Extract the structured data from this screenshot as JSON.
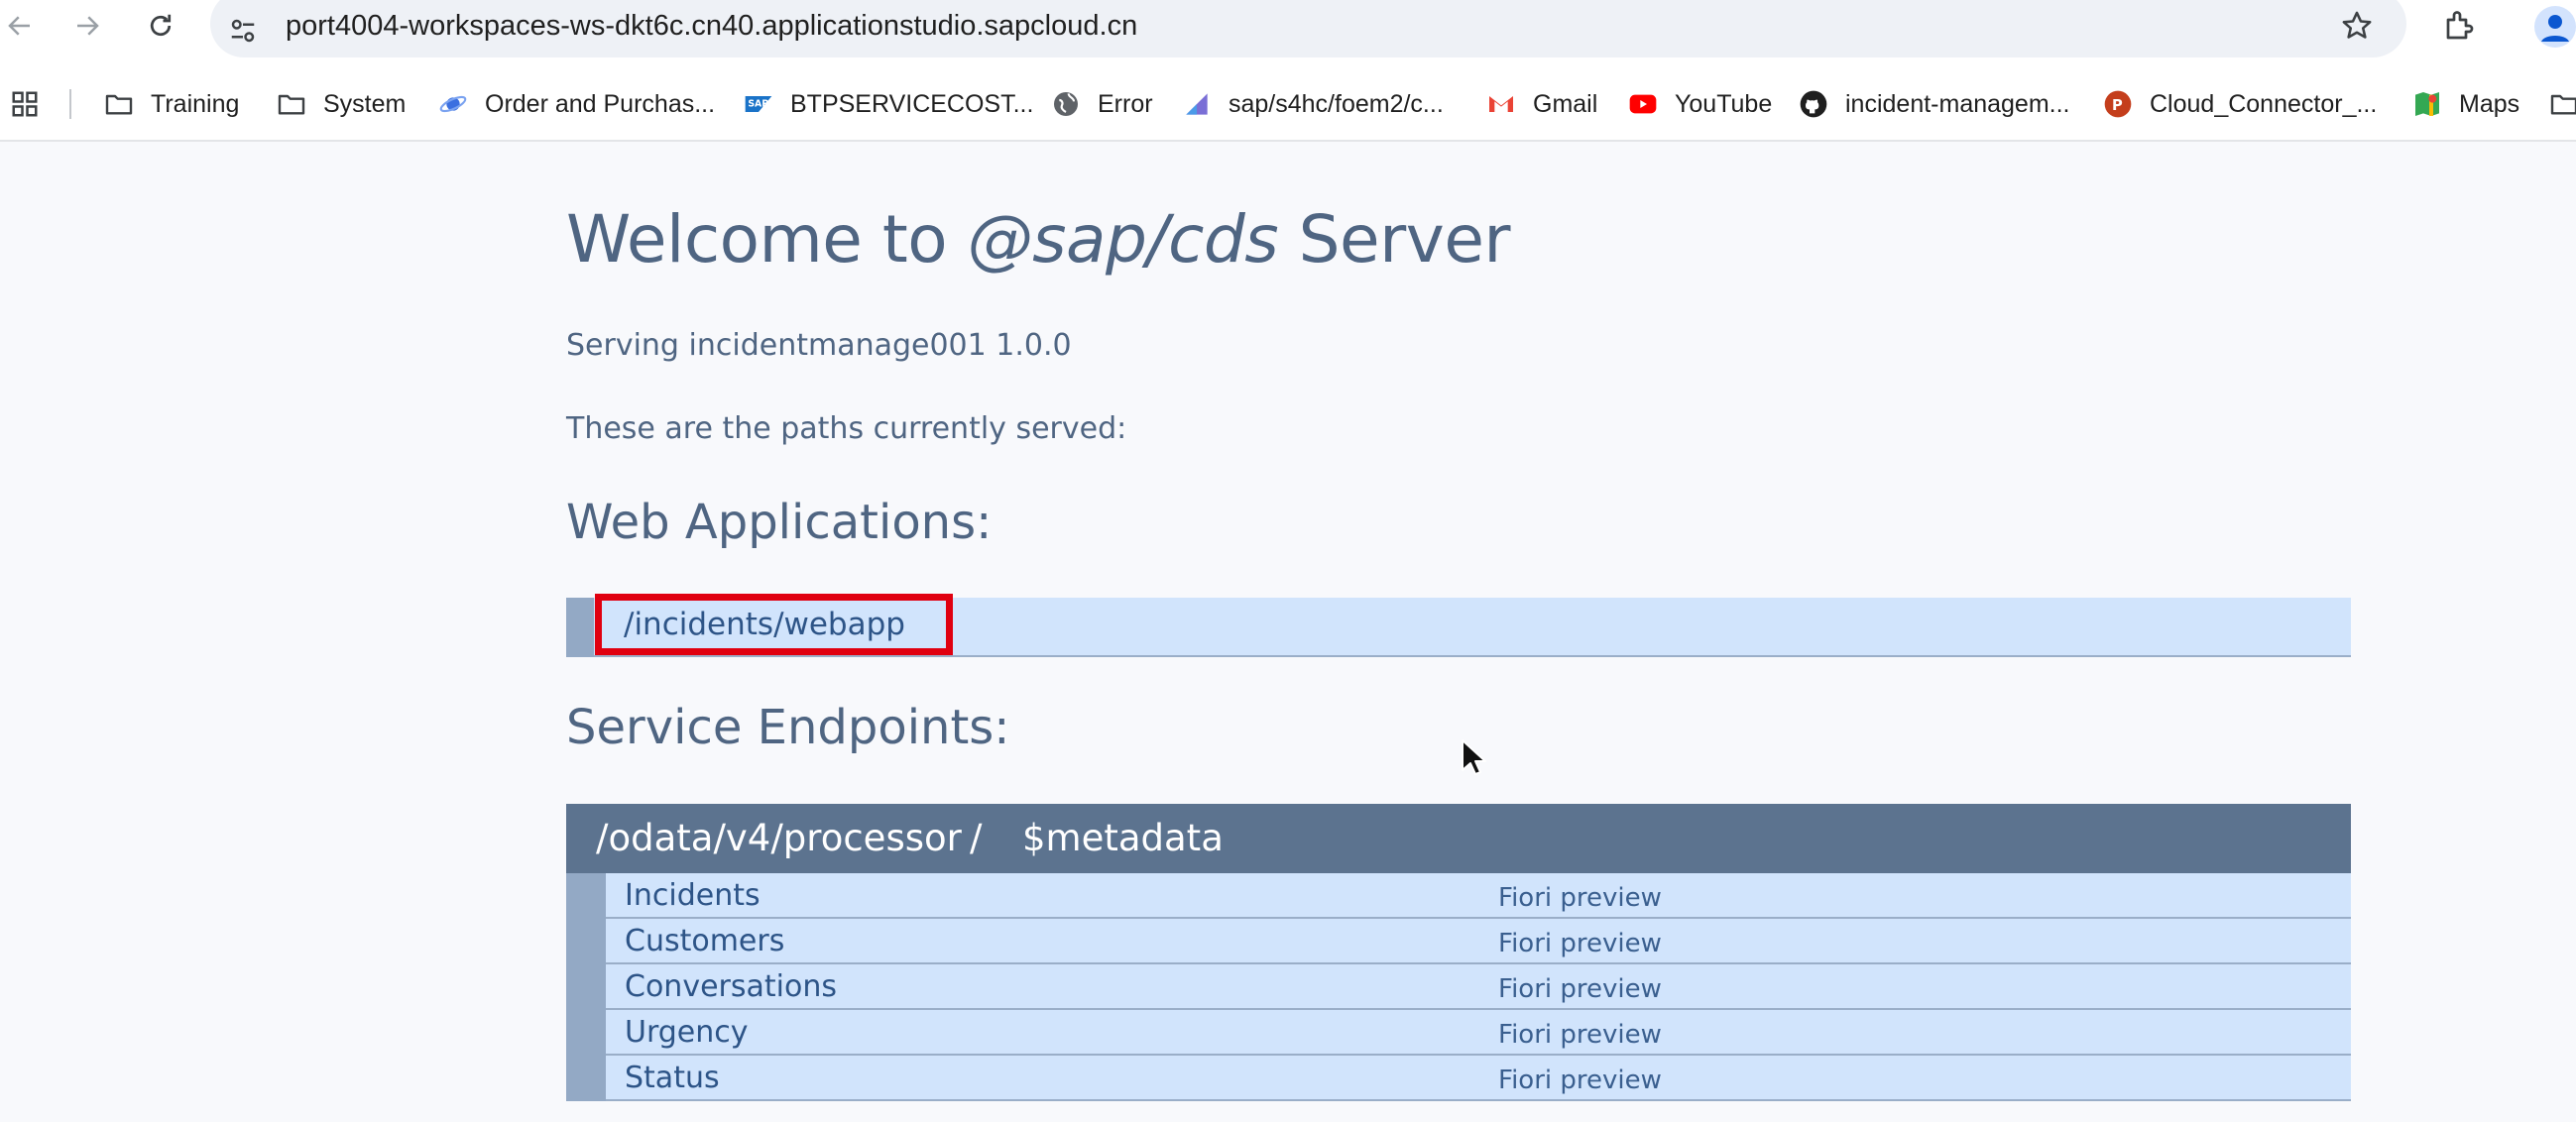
{
  "browser": {
    "url": "port4004-workspaces-ws-dkt6c.cn40.applicationstudio.sapcloud.cn",
    "bookmarks": [
      {
        "label": "Training",
        "icon": "folder-icon"
      },
      {
        "label": "System",
        "icon": "folder-icon"
      },
      {
        "label": "Order and Purchas...",
        "icon": "planet-icon"
      },
      {
        "label": "BTPSERVICECOST...",
        "icon": "sap-logo-icon"
      },
      {
        "label": "Error",
        "icon": "globe-icon"
      },
      {
        "label": "sap/s4hc/foem2/c...",
        "icon": "chart-icon"
      },
      {
        "label": "Gmail",
        "icon": "gmail-icon"
      },
      {
        "label": "YouTube",
        "icon": "youtube-icon"
      },
      {
        "label": "incident-managem...",
        "icon": "github-icon"
      },
      {
        "label": "Cloud_Connector_...",
        "icon": "powerpoint-icon"
      },
      {
        "label": "Maps",
        "icon": "maps-icon"
      },
      {
        "label": "",
        "icon": "folder-icon"
      }
    ]
  },
  "page": {
    "title_prefix": "Welcome to ",
    "title_em": "@sap/cds",
    "title_suffix": " Server",
    "serving": "Serving incidentmanage001 1.0.0",
    "paths_intro": "These are the paths currently served:",
    "webapps_heading": "Web Applications:",
    "webapp_link": "/incidents/webapp",
    "endpoints_heading": "Service Endpoints:",
    "service": {
      "path": "/odata/v4/processor",
      "separator": "/",
      "metadata": "$metadata"
    },
    "entities": [
      {
        "name": "Incidents",
        "preview": "Fiori preview"
      },
      {
        "name": "Customers",
        "preview": "Fiori preview"
      },
      {
        "name": "Conversations",
        "preview": "Fiori preview"
      },
      {
        "name": "Urgency",
        "preview": "Fiori preview"
      },
      {
        "name": "Status",
        "preview": "Fiori preview"
      }
    ]
  },
  "colors": {
    "highlight": "#e00010",
    "service_header": "#5c738f",
    "row_bg": "#d1e4fc"
  }
}
